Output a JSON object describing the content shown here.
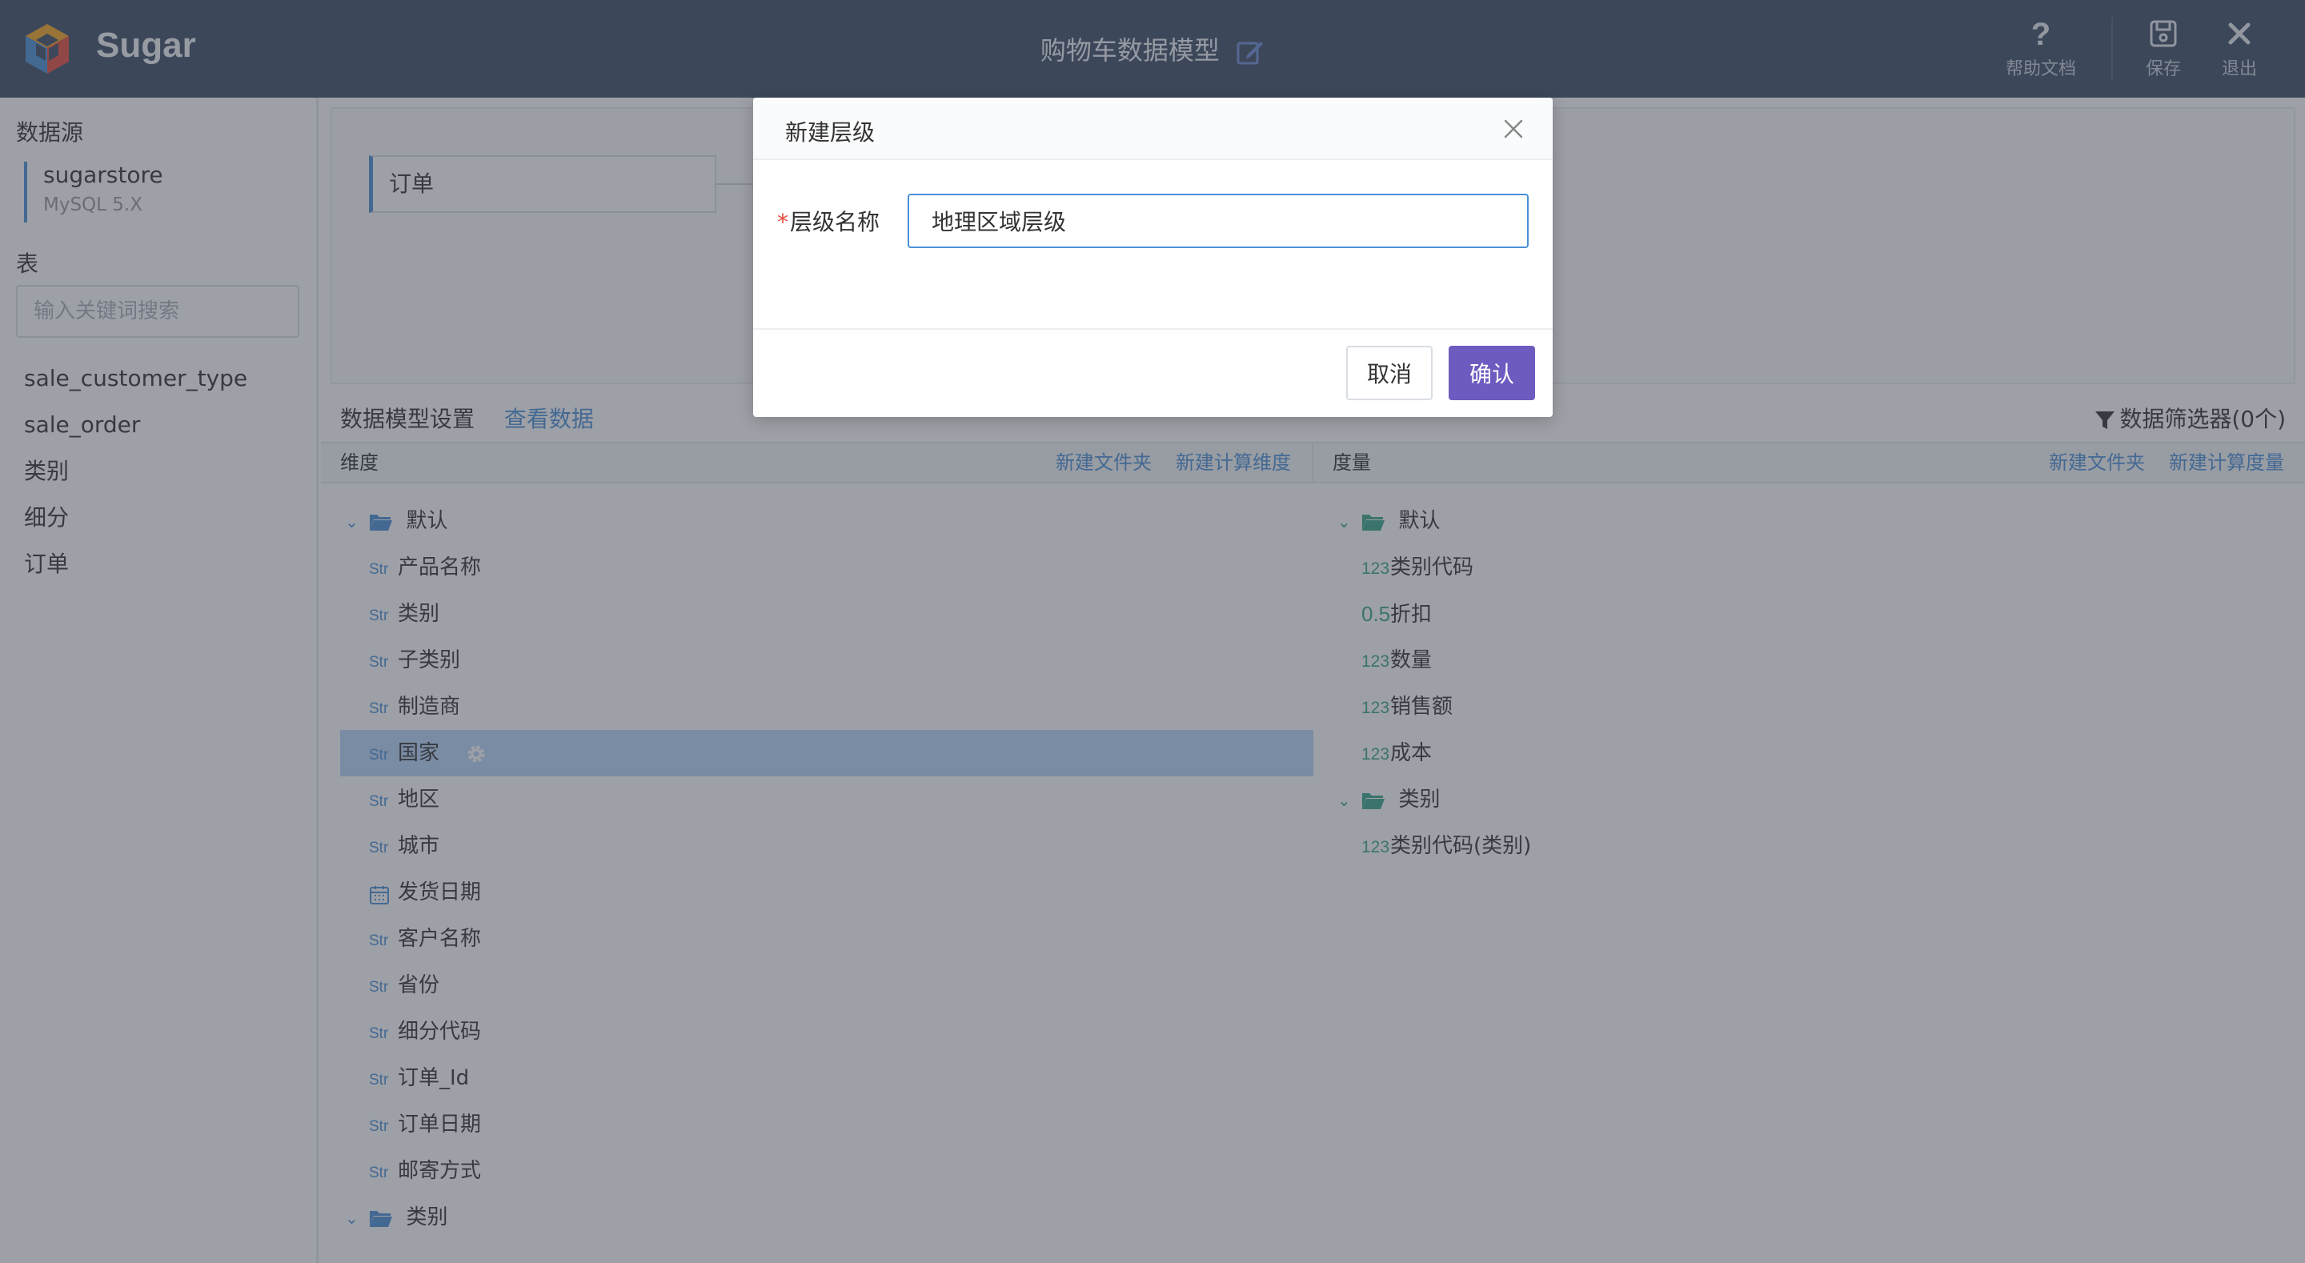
{
  "header": {
    "app_name": "Sugar",
    "title": "购物车数据模型",
    "help_label": "帮助文档",
    "save_label": "保存",
    "exit_label": "退出",
    "accent_color": "#3d4c67"
  },
  "sidebar": {
    "datasource_label": "数据源",
    "datasource": {
      "name": "sugarstore",
      "type": "MySQL 5.X"
    },
    "tables_label": "表",
    "search_placeholder": "输入关键词搜索",
    "tables": [
      "sale_customer_type",
      "sale_order",
      "类别",
      "细分",
      "订单"
    ]
  },
  "canvas": {
    "table_node": "订单"
  },
  "tabs": {
    "model_settings": "数据模型设置",
    "view_data": "查看数据"
  },
  "filter_label": "数据筛选器(0个)",
  "dimensions": {
    "header": "维度",
    "new_folder": "新建文件夹",
    "new_calc": "新建计算维度",
    "folders": [
      {
        "name": "默认",
        "fields": [
          {
            "type": "Str",
            "name": "产品名称"
          },
          {
            "type": "Str",
            "name": "类别"
          },
          {
            "type": "Str",
            "name": "子类别"
          },
          {
            "type": "Str",
            "name": "制造商"
          },
          {
            "type": "Str",
            "name": "国家",
            "selected": true
          },
          {
            "type": "Str",
            "name": "地区"
          },
          {
            "type": "Str",
            "name": "城市"
          },
          {
            "type": "calendar-icon",
            "name": "发货日期"
          },
          {
            "type": "Str",
            "name": "客户名称"
          },
          {
            "type": "Str",
            "name": "省份"
          },
          {
            "type": "Str",
            "name": "细分代码"
          },
          {
            "type": "Str",
            "name": "订单_Id"
          },
          {
            "type": "Str",
            "name": "订单日期"
          },
          {
            "type": "Str",
            "name": "邮寄方式"
          }
        ]
      },
      {
        "name": "类别",
        "fields": []
      }
    ]
  },
  "measures": {
    "header": "度量",
    "new_folder": "新建文件夹",
    "new_calc": "新建计算度量",
    "folders": [
      {
        "name": "默认",
        "fields": [
          {
            "type": "123",
            "name": "类别代码"
          },
          {
            "type": "0.5",
            "name": "折扣"
          },
          {
            "type": "123",
            "name": "数量"
          },
          {
            "type": "123",
            "name": "销售额"
          },
          {
            "type": "123",
            "name": "成本"
          }
        ]
      },
      {
        "name": "类别",
        "fields": [
          {
            "type": "123",
            "name": "类别代码(类别)"
          }
        ]
      }
    ]
  },
  "modal": {
    "title": "新建层级",
    "required_mark": "*",
    "field_label": "层级名称",
    "field_value": "地理区域层级",
    "cancel_label": "取消",
    "confirm_label": "确认",
    "confirm_color": "#6e5bc0"
  }
}
